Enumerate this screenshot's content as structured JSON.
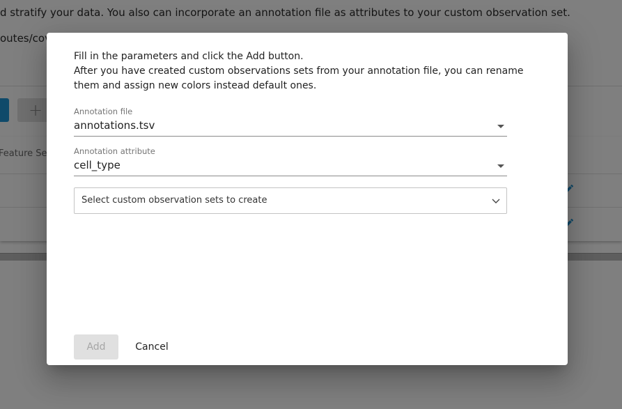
{
  "background": {
    "paragraph_fragment": "d stratify your data. You also can incorporate an annotation file as attributes to your custom observation set.",
    "path_fragment": "outes/cova",
    "add_button_symbol": "+",
    "table": {
      "column_header_fragment": "Feature Set"
    },
    "colors": {
      "primary_button": "#1f95d4",
      "edit_icon": "#1f95d4"
    },
    "icons": {
      "row_action": "pencil-icon"
    }
  },
  "dialog": {
    "intro_line1": "Fill in the parameters and click the Add button.",
    "intro_line2": "After you have created custom observations sets from your annotation file, you can rename them and assign new colors instead default ones.",
    "annotation_file": {
      "label": "Annotation file",
      "value": "annotations.tsv"
    },
    "annotation_attribute": {
      "label": "Annotation attribute",
      "value": "cell_type"
    },
    "observation_sets_select": {
      "placeholder": "Select custom observation sets to create"
    },
    "add_button": "Add",
    "cancel_button": "Cancel",
    "add_button_state": "disabled"
  }
}
